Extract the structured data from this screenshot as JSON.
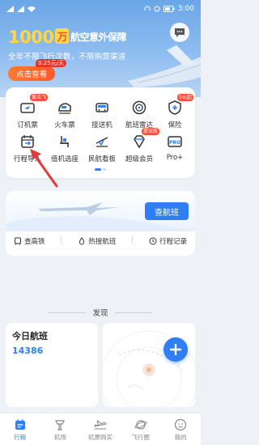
{
  "status_bar": {
    "time": "3:00",
    "battery": "58"
  },
  "hero": {
    "amount": "1000",
    "unit": "万",
    "title_rest": "航空意外保障",
    "subtitle": "全年不限飞行次数，不限购票渠道",
    "button": "点击查看",
    "badge": "0.25元/天"
  },
  "services": [
    {
      "label": "订机票",
      "icon": "plane-ticket-icon",
      "tag": "爱点飞"
    },
    {
      "label": "火车票",
      "icon": "train-icon",
      "tag": ""
    },
    {
      "label": "接送机",
      "icon": "car-icon",
      "tag": ""
    },
    {
      "label": "航班雷达",
      "icon": "radar-icon",
      "tag": ""
    },
    {
      "label": "保险",
      "icon": "insurance-icon",
      "tag": "0元起"
    },
    {
      "label": "行程导入",
      "icon": "calendar-import-icon",
      "tag": ""
    },
    {
      "label": "值机选座",
      "icon": "seat-icon",
      "tag": ""
    },
    {
      "label": "民航看板",
      "icon": "board-icon",
      "tag": ""
    },
    {
      "label": "超级会员",
      "icon": "diamond-icon",
      "tag": "提深航"
    },
    {
      "label": "Pro+",
      "icon": "pro-icon",
      "tag": ""
    }
  ],
  "flight_search": {
    "button": "查航班",
    "links": [
      "查高铁",
      "热搜航班",
      "行程记录"
    ]
  },
  "discover": {
    "title": "发现"
  },
  "today_flights": {
    "title": "今日航班",
    "count": "14386"
  },
  "tabs": [
    {
      "label": "行程",
      "active": true
    },
    {
      "label": "机场",
      "active": false
    },
    {
      "label": "机票购买",
      "active": false
    },
    {
      "label": "飞行圈",
      "active": false
    },
    {
      "label": "我的",
      "active": false
    }
  ],
  "colors": {
    "accent": "#2f7ef5",
    "hero_gold": "#ffd54a",
    "cta_orange": "#ff6a2c"
  }
}
